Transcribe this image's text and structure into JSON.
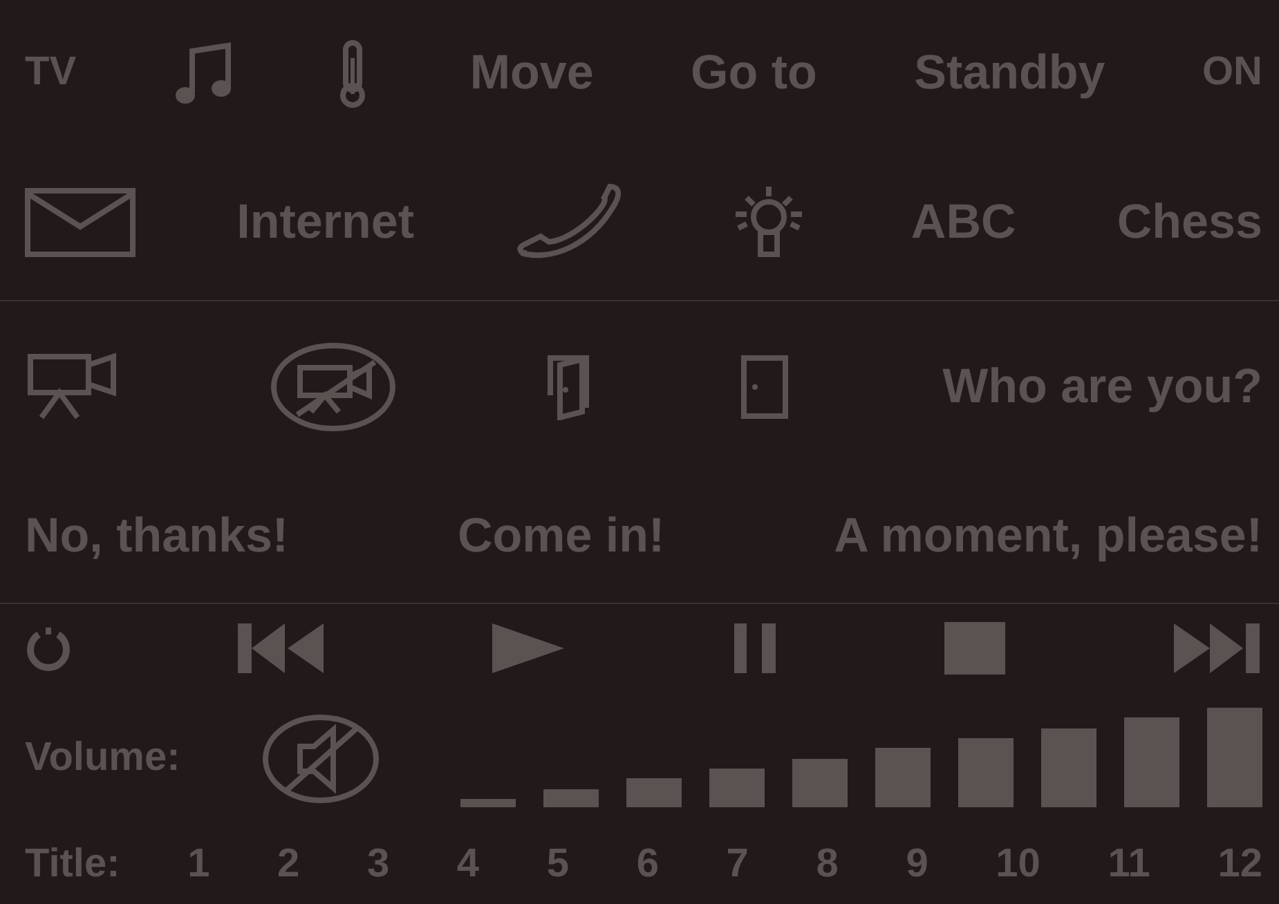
{
  "sections": [
    {
      "rows": [
        {
          "items": [
            {
              "kind": "caption",
              "label": "TV"
            },
            {
              "kind": "music"
            },
            {
              "kind": "thermometer"
            },
            {
              "kind": "text",
              "label": "Move"
            },
            {
              "kind": "text",
              "label": "Go to"
            },
            {
              "kind": "text",
              "label": "Standby"
            },
            {
              "kind": "caption",
              "label": "ON"
            }
          ]
        },
        {
          "items": [
            {
              "kind": "mail"
            },
            {
              "kind": "text",
              "label": "Internet"
            },
            {
              "kind": "phone"
            },
            {
              "kind": "bulb"
            },
            {
              "kind": "text",
              "label": "ABC"
            },
            {
              "kind": "text",
              "label": "Chess"
            }
          ]
        }
      ]
    },
    {
      "rows": [
        {
          "items": [
            {
              "kind": "camera"
            },
            {
              "kind": "camera-off"
            },
            {
              "kind": "door-open"
            },
            {
              "kind": "door-closed"
            },
            {
              "kind": "text",
              "label": "Who are you?"
            }
          ]
        },
        {
          "items": [
            {
              "kind": "text",
              "label": "No, thanks!"
            },
            {
              "kind": "text",
              "label": "Come in!"
            },
            {
              "kind": "text",
              "label": "A moment, please!"
            }
          ]
        }
      ]
    },
    {
      "rows": [
        {
          "items": [
            {
              "kind": "power"
            },
            {
              "kind": "prev"
            },
            {
              "kind": "play"
            },
            {
              "kind": "pause"
            },
            {
              "kind": "stop"
            },
            {
              "kind": "next"
            }
          ]
        },
        {
          "items": [
            {
              "kind": "caption",
              "label": "Volume:"
            },
            {
              "kind": "mute"
            },
            {
              "kind": "volume"
            }
          ]
        },
        {
          "items": [
            {
              "kind": "caption",
              "label": "Title:"
            },
            {
              "kind": "caption",
              "label": "1"
            },
            {
              "kind": "caption",
              "label": "2"
            },
            {
              "kind": "caption",
              "label": "3"
            },
            {
              "kind": "caption",
              "label": "4"
            },
            {
              "kind": "caption",
              "label": "5"
            },
            {
              "kind": "caption",
              "label": "6"
            },
            {
              "kind": "caption",
              "label": "7"
            },
            {
              "kind": "caption",
              "label": "8"
            },
            {
              "kind": "caption",
              "label": "9"
            },
            {
              "kind": "caption",
              "label": "10"
            },
            {
              "kind": "caption",
              "label": "11"
            },
            {
              "kind": "caption",
              "label": "12"
            }
          ]
        }
      ]
    }
  ]
}
